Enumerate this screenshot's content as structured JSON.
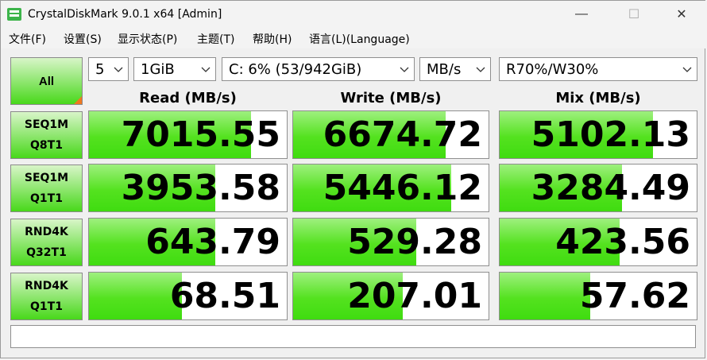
{
  "window": {
    "title": "CrystalDiskMark 9.0.1 x64 [Admin]",
    "minimize_glyph": "—",
    "maximize_glyph": "☐",
    "close_glyph": "✕"
  },
  "menu": {
    "items": [
      {
        "label": "文件(F)"
      },
      {
        "label": "设置(S)"
      },
      {
        "label": "显示状态(P)"
      },
      {
        "label": "主题(T)"
      },
      {
        "label": "帮助(H)"
      },
      {
        "label": "语言(L)(Language)"
      }
    ]
  },
  "toolbar": {
    "all_label": "All",
    "count": "5",
    "size": "1GiB",
    "drive": "C: 6% (53/942GiB)",
    "unit": "MB/s",
    "mix": "R70%/W30%"
  },
  "headers": {
    "read": "Read (MB/s)",
    "write": "Write (MB/s)",
    "mix": "Mix (MB/s)"
  },
  "tests": [
    {
      "line1": "SEQ1M",
      "line2": "Q8T1",
      "read": "7015.55",
      "write": "6674.72",
      "mix": "5102.13",
      "read_fill": 0.82,
      "write_fill": 0.78,
      "mix_fill": 0.78
    },
    {
      "line1": "SEQ1M",
      "line2": "Q1T1",
      "read": "3953.58",
      "write": "5446.12",
      "mix": "3284.49",
      "read_fill": 0.64,
      "write_fill": 0.81,
      "mix_fill": 0.62
    },
    {
      "line1": "RND4K",
      "line2": "Q32T1",
      "read": "643.79",
      "write": "529.28",
      "mix": "423.56",
      "read_fill": 0.64,
      "write_fill": 0.63,
      "mix_fill": 0.61
    },
    {
      "line1": "RND4K",
      "line2": "Q1T1",
      "read": "68.51",
      "write": "207.01",
      "mix": "57.62",
      "read_fill": 0.47,
      "write_fill": 0.56,
      "mix_fill": 0.46
    }
  ],
  "status": {
    "text": ""
  },
  "colors": {
    "bar_green": "#3fdc10",
    "all_corner": "#f07820"
  }
}
